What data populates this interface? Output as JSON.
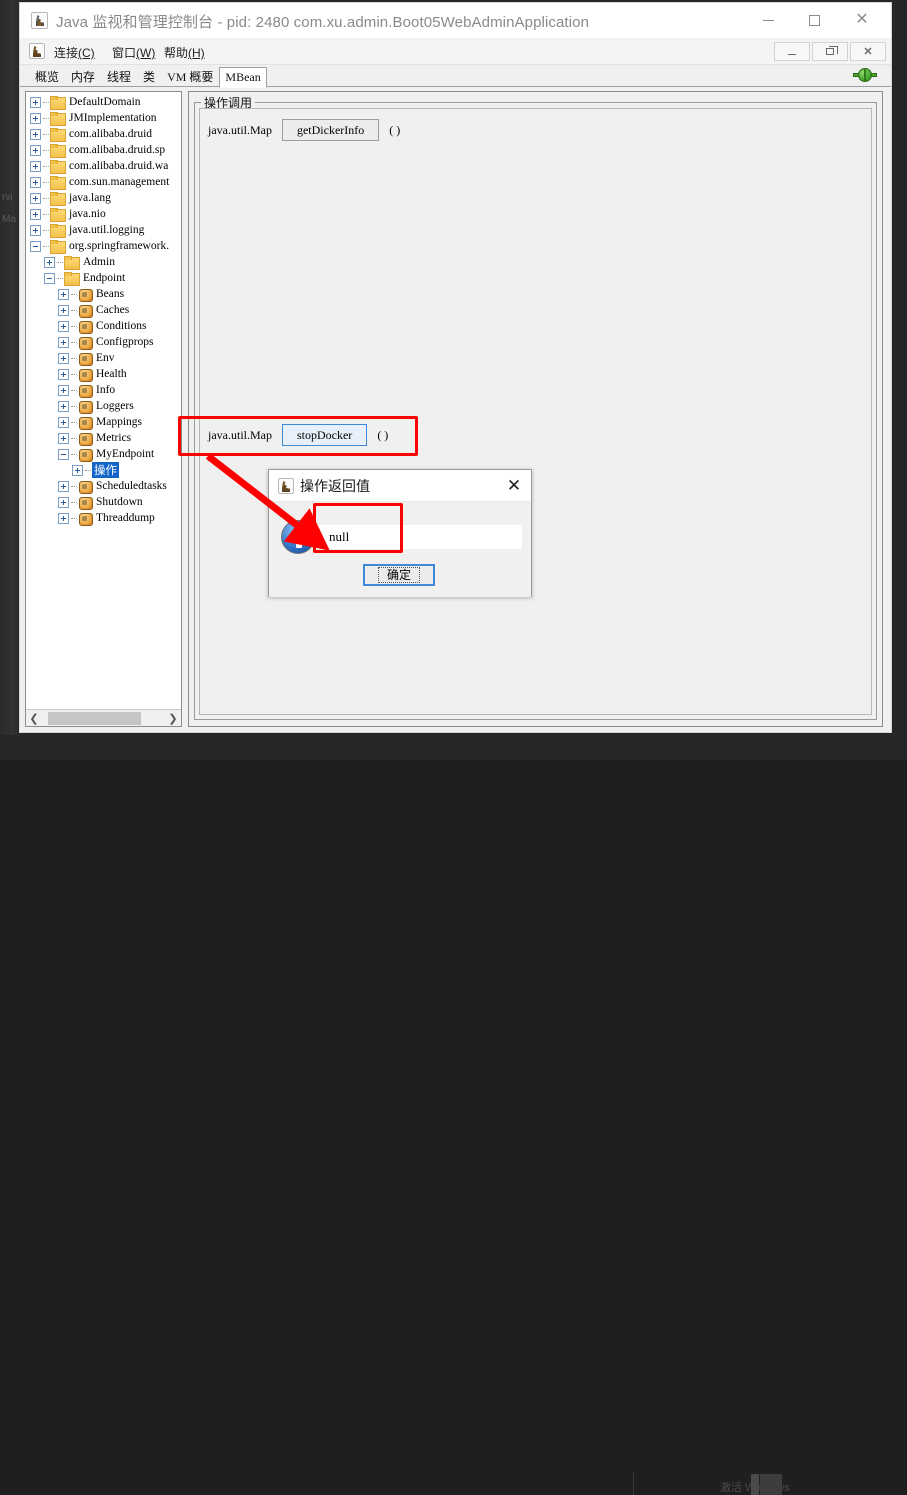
{
  "window": {
    "title": "Java 监视和管理控制台 - pid: 2480 com.xu.admin.Boot05WebAdminApplication",
    "icon": "java-cup-icon",
    "minimize_label": "—",
    "maximize_label": "□",
    "close_label": "✕"
  },
  "menubar": {
    "icon": "java-cup-icon",
    "items": [
      {
        "text": "连接",
        "mnemonic": "(C)"
      },
      {
        "text": "窗口",
        "mnemonic": "(W)"
      },
      {
        "text": "帮助",
        "mnemonic": "(H)"
      }
    ],
    "inner_minimize": "_",
    "inner_restore": "❐",
    "inner_close": "✕"
  },
  "tabs": {
    "items": [
      {
        "label": "概览",
        "selected": false
      },
      {
        "label": "内存",
        "selected": false
      },
      {
        "label": "线程",
        "selected": false
      },
      {
        "label": "类",
        "selected": false
      },
      {
        "label": "VM 概要",
        "selected": false
      },
      {
        "label": "MBean",
        "selected": true
      }
    ],
    "connection_icon": "green-plug-connected-icon"
  },
  "tree": {
    "nodes": [
      {
        "label": "DefaultDomain",
        "indent": 0,
        "icon": "folder",
        "expander": "plus"
      },
      {
        "label": "JMImplementation",
        "indent": 0,
        "icon": "folder",
        "expander": "plus"
      },
      {
        "label": "com.alibaba.druid",
        "indent": 0,
        "icon": "folder",
        "expander": "plus"
      },
      {
        "label": "com.alibaba.druid.sp",
        "indent": 0,
        "icon": "folder",
        "expander": "plus"
      },
      {
        "label": "com.alibaba.druid.wa",
        "indent": 0,
        "icon": "folder",
        "expander": "plus"
      },
      {
        "label": "com.sun.management",
        "indent": 0,
        "icon": "folder",
        "expander": "plus"
      },
      {
        "label": "java.lang",
        "indent": 0,
        "icon": "folder",
        "expander": "plus"
      },
      {
        "label": "java.nio",
        "indent": 0,
        "icon": "folder",
        "expander": "plus"
      },
      {
        "label": "java.util.logging",
        "indent": 0,
        "icon": "folder",
        "expander": "plus"
      },
      {
        "label": "org.springframework.",
        "indent": 0,
        "icon": "folder",
        "expander": "minus"
      },
      {
        "label": "Admin",
        "indent": 1,
        "icon": "folder",
        "expander": "plus"
      },
      {
        "label": "Endpoint",
        "indent": 1,
        "icon": "folder",
        "expander": "minus"
      },
      {
        "label": "Beans",
        "indent": 2,
        "icon": "mbean",
        "expander": "plus"
      },
      {
        "label": "Caches",
        "indent": 2,
        "icon": "mbean",
        "expander": "plus"
      },
      {
        "label": "Conditions",
        "indent": 2,
        "icon": "mbean",
        "expander": "plus"
      },
      {
        "label": "Configprops",
        "indent": 2,
        "icon": "mbean",
        "expander": "plus"
      },
      {
        "label": "Env",
        "indent": 2,
        "icon": "mbean",
        "expander": "plus"
      },
      {
        "label": "Health",
        "indent": 2,
        "icon": "mbean",
        "expander": "plus"
      },
      {
        "label": "Info",
        "indent": 2,
        "icon": "mbean",
        "expander": "plus"
      },
      {
        "label": "Loggers",
        "indent": 2,
        "icon": "mbean",
        "expander": "plus"
      },
      {
        "label": "Mappings",
        "indent": 2,
        "icon": "mbean",
        "expander": "plus"
      },
      {
        "label": "Metrics",
        "indent": 2,
        "icon": "mbean",
        "expander": "plus"
      },
      {
        "label": "MyEndpoint",
        "indent": 2,
        "icon": "mbean",
        "expander": "minus"
      },
      {
        "label": "操作",
        "indent": 3,
        "icon": "none",
        "expander": "plus",
        "selected": true
      },
      {
        "label": "Scheduledtasks",
        "indent": 2,
        "icon": "mbean",
        "expander": "plus"
      },
      {
        "label": "Shutdown",
        "indent": 2,
        "icon": "mbean",
        "expander": "plus"
      },
      {
        "label": "Threaddump",
        "indent": 2,
        "icon": "mbean",
        "expander": "plus"
      }
    ],
    "hscroll_left": "❮",
    "hscroll_right": "❯"
  },
  "content": {
    "group_title": "操作调用",
    "operations": [
      {
        "return_type": "java.util.Map",
        "method": "getDickerInfo",
        "args": "( )",
        "focused": false
      },
      {
        "return_type": "java.util.Map",
        "method": "stopDocker",
        "args": "( )",
        "focused": true
      }
    ]
  },
  "dialog": {
    "icon": "java-cup-icon",
    "title": "操作返回值",
    "close_label": "✕",
    "info_icon": "info-circle-icon",
    "value": "null",
    "ok_label": "确定"
  },
  "annotations": {
    "arrow_color": "#ff0000",
    "box_color": "#ff0000",
    "highlighted": [
      "stopDocker operation row",
      "null return value field"
    ]
  },
  "desktop": {
    "watermark": "激活 Windows",
    "ghost_texts": [
      "rvi",
      "Ma"
    ]
  }
}
